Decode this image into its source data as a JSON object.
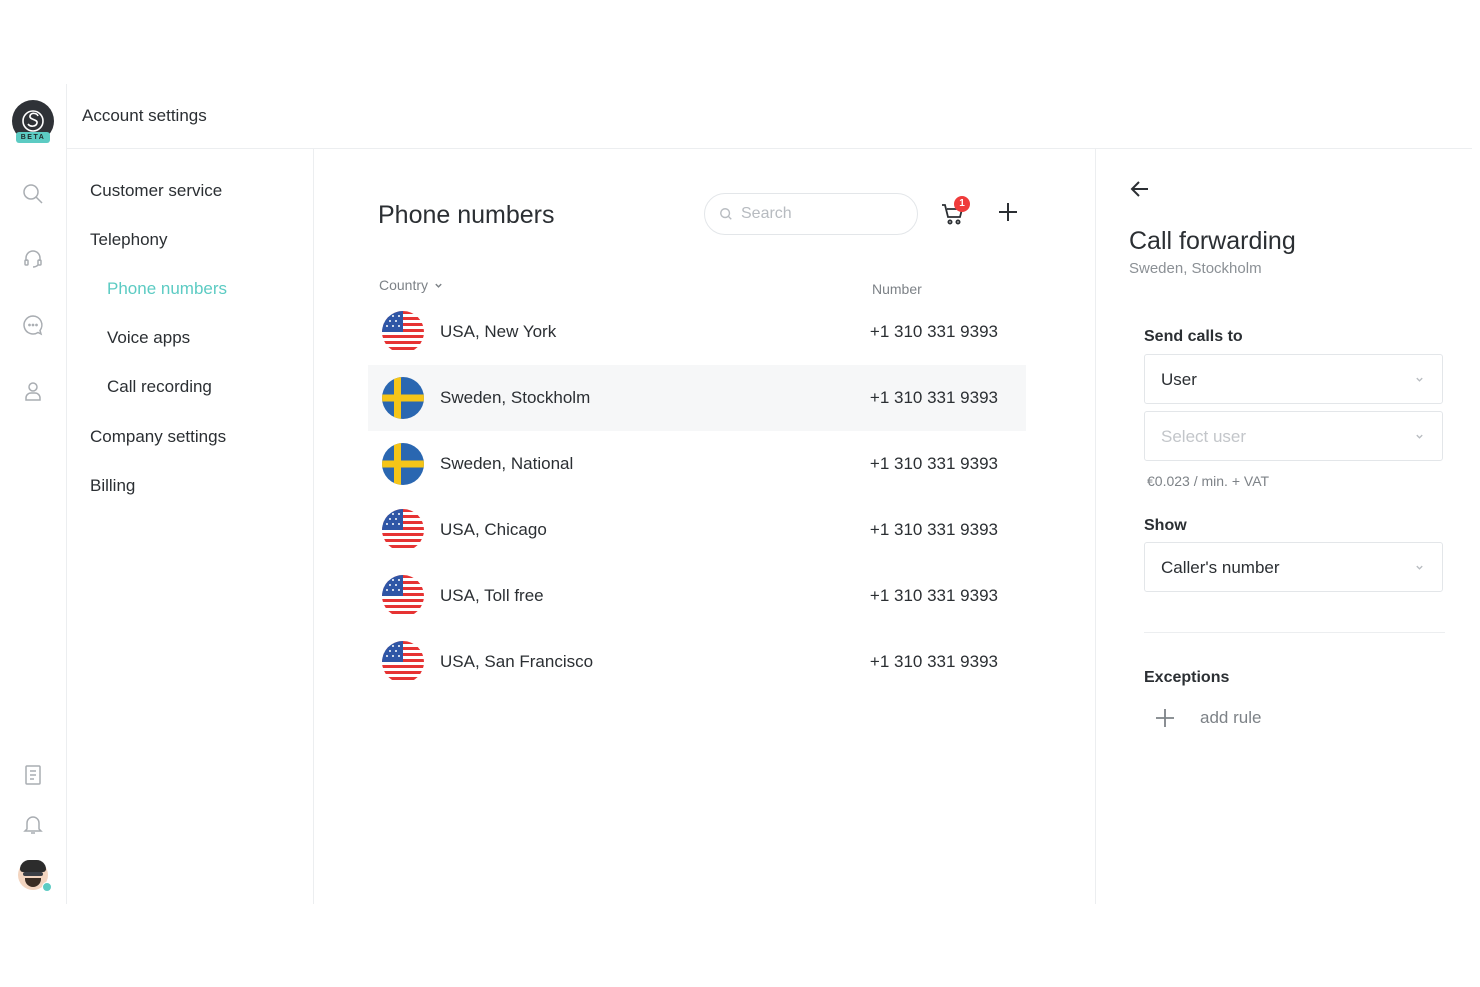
{
  "header": {
    "title": "Account settings"
  },
  "logo": {
    "badge": "BETA"
  },
  "nav": {
    "items": [
      {
        "label": "Customer service"
      },
      {
        "label": "Telephony"
      },
      {
        "label": "Phone numbers",
        "active": true
      },
      {
        "label": "Voice apps"
      },
      {
        "label": "Call recording"
      },
      {
        "label": "Company settings"
      },
      {
        "label": "Billing"
      }
    ]
  },
  "main": {
    "title": "Phone numbers",
    "search_placeholder": "Search",
    "cart_count": "1",
    "columns": {
      "country": "Country",
      "number": "Number"
    },
    "rows": [
      {
        "name": "USA, New York",
        "number": "+1 310 331 9393",
        "flag": "usa"
      },
      {
        "name": "Sweden, Stockholm",
        "number": "+1 310 331 9393",
        "flag": "sweden"
      },
      {
        "name": "Sweden, National",
        "number": "+1 310 331 9393",
        "flag": "sweden"
      },
      {
        "name": "USA, Chicago",
        "number": "+1 310 331 9393",
        "flag": "usa"
      },
      {
        "name": "USA, Toll free",
        "number": "+1 310 331 9393",
        "flag": "usa"
      },
      {
        "name": "USA, San Francisco",
        "number": "+1 310 331 9393",
        "flag": "usa"
      }
    ]
  },
  "panel": {
    "title": "Call forwarding",
    "subtitle": "Sweden, Stockholm",
    "send_calls_label": "Send calls to",
    "send_calls_value": "User",
    "select_user_placeholder": "Select user",
    "price": "€0.023 / min. + VAT",
    "show_label": "Show",
    "show_value": "Caller's number",
    "exceptions_label": "Exceptions",
    "add_rule_label": "add rule"
  },
  "colors": {
    "accent": "#5ccbc3",
    "badge": "#ef3b3b",
    "selected_row": "#f6f7f8"
  }
}
